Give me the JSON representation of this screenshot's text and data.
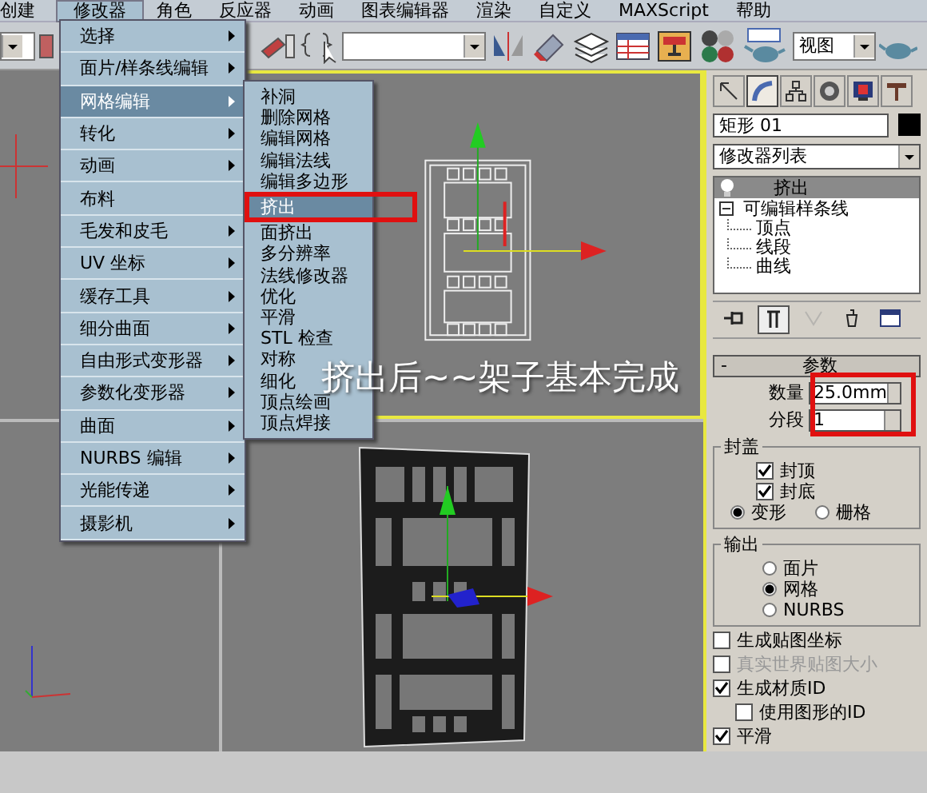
{
  "menu_bar": [
    {
      "label": "创建",
      "selected": false
    },
    {
      "label": "修改器",
      "selected": true
    },
    {
      "label": "角色",
      "selected": false
    },
    {
      "label": "反应器",
      "selected": false
    },
    {
      "label": "动画",
      "selected": false
    },
    {
      "label": "图表编辑器",
      "selected": false
    },
    {
      "label": "渲染",
      "selected": false
    },
    {
      "label": "自定义",
      "selected": false
    },
    {
      "label": "MAXScript",
      "selected": false
    },
    {
      "label": "帮助",
      "selected": false
    }
  ],
  "toolbar": {
    "view_dropdown": "视图"
  },
  "modifiers_menu": [
    {
      "label": "选择",
      "submenu": true,
      "selected": false
    },
    {
      "label": "面片/样条线编辑",
      "submenu": true,
      "selected": false
    },
    {
      "label": "网格编辑",
      "submenu": true,
      "selected": true
    },
    {
      "label": "转化",
      "submenu": true,
      "selected": false
    },
    {
      "label": "动画",
      "submenu": true,
      "selected": false
    },
    {
      "label": "布料",
      "submenu": false,
      "selected": false
    },
    {
      "label": "毛发和皮毛",
      "submenu": true,
      "selected": false
    },
    {
      "label": "UV 坐标",
      "submenu": true,
      "selected": false
    },
    {
      "label": "缓存工具",
      "submenu": true,
      "selected": false
    },
    {
      "label": "细分曲面",
      "submenu": true,
      "selected": false
    },
    {
      "label": "自由形式变形器",
      "submenu": true,
      "selected": false
    },
    {
      "label": "参数化变形器",
      "submenu": true,
      "selected": false
    },
    {
      "label": "曲面",
      "submenu": true,
      "selected": false
    },
    {
      "label": "NURBS 编辑",
      "submenu": true,
      "selected": false
    },
    {
      "label": "光能传递",
      "submenu": true,
      "selected": false
    },
    {
      "label": "摄影机",
      "submenu": true,
      "selected": false
    }
  ],
  "mesh_editing_submenu": [
    {
      "label": "补洞",
      "selected": false
    },
    {
      "label": "删除网格",
      "selected": false
    },
    {
      "label": "编辑网格",
      "selected": false
    },
    {
      "label": "编辑法线",
      "selected": false
    },
    {
      "label": "编辑多边形",
      "selected": false
    },
    {
      "label": "挤出",
      "selected": true
    },
    {
      "label": "面挤出",
      "selected": false
    },
    {
      "label": "多分辨率",
      "selected": false
    },
    {
      "label": "法线修改器",
      "selected": false
    },
    {
      "label": "优化",
      "selected": false
    },
    {
      "label": "平滑",
      "selected": false
    },
    {
      "label": "STL 检查",
      "selected": false
    },
    {
      "label": "对称",
      "selected": false
    },
    {
      "label": "细化",
      "selected": false
    },
    {
      "label": "顶点绘画",
      "selected": false
    },
    {
      "label": "顶点焊接",
      "selected": false
    }
  ],
  "viewport_caption": "挤出后~~架子基本完成",
  "command_panel": {
    "tabs": [
      {
        "selected": false
      },
      {
        "selected": true
      },
      {
        "selected": false
      },
      {
        "selected": false
      },
      {
        "selected": false
      },
      {
        "selected": false
      }
    ],
    "object_name": "矩形 01",
    "modifier_list": "修改器列表",
    "stack": [
      {
        "label": "挤出",
        "selected": true
      },
      {
        "label": "可编辑样条线",
        "selected": false,
        "expanded": true,
        "children": [
          {
            "label": "顶点",
            "selected": false
          },
          {
            "label": "线段",
            "selected": false
          },
          {
            "label": "曲线",
            "selected": false
          }
        ]
      }
    ],
    "stack_tools": [
      {
        "selected": false,
        "disabled": false
      },
      {
        "selected": true,
        "disabled": false
      },
      {
        "selected": false,
        "disabled": true
      },
      {
        "selected": false,
        "disabled": false
      },
      {
        "selected": false,
        "disabled": false
      }
    ],
    "parameters": {
      "toggle": "-",
      "title": "参数",
      "fields": [
        {
          "label": "数量",
          "value": "25.0mm"
        },
        {
          "label": "分段",
          "value": "1"
        }
      ],
      "capping": {
        "title": "封盖",
        "checks": [
          {
            "label": "封顶",
            "checked": true
          },
          {
            "label": "封底",
            "checked": true
          }
        ],
        "options": [
          {
            "label": "变形",
            "selected": true
          },
          {
            "label": "栅格",
            "selected": false
          }
        ]
      },
      "output": {
        "title": "输出",
        "options": [
          {
            "label": "面片",
            "selected": false
          },
          {
            "label": "网格",
            "selected": true
          },
          {
            "label": "NURBS",
            "selected": false
          }
        ]
      },
      "checks": [
        {
          "label": "生成贴图坐标",
          "checked": false,
          "disabled": false
        },
        {
          "label": "真实世界贴图大小",
          "checked": false,
          "disabled": true
        },
        {
          "label": "生成材质ID",
          "checked": true,
          "disabled": false,
          "children": [
            {
              "label": "使用图形的ID",
              "checked": false,
              "disabled": false
            }
          ]
        },
        {
          "label": "平滑",
          "checked": true,
          "disabled": false
        }
      ]
    }
  }
}
